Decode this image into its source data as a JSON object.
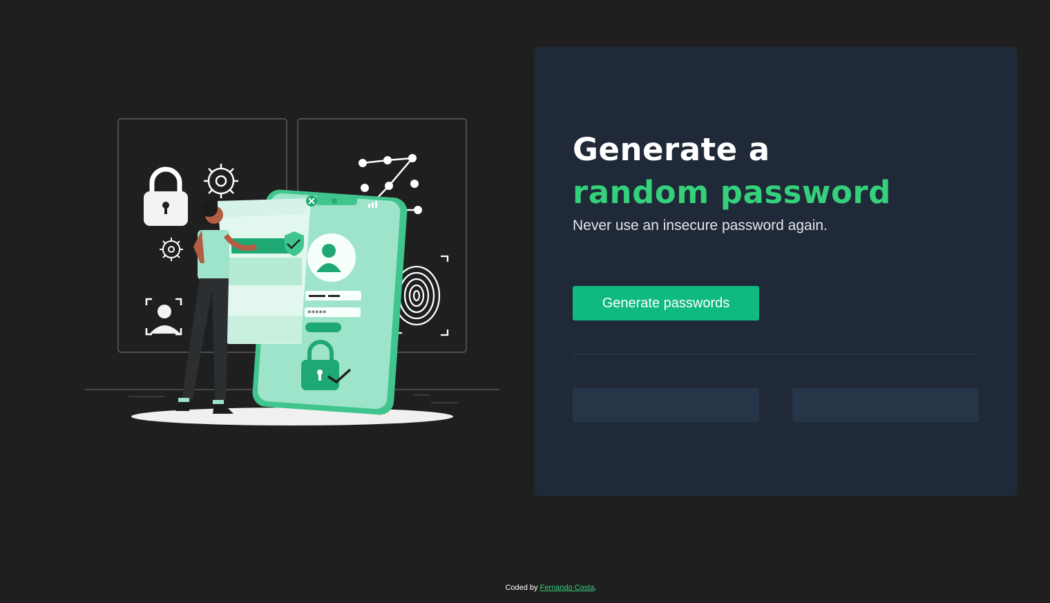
{
  "hero": {
    "title_line1": "Generate a",
    "title_line2": "random password",
    "subtitle": "Never use an insecure password again."
  },
  "actions": {
    "generate_label": "Generate passwords"
  },
  "passwords": {
    "first": "",
    "second": ""
  },
  "footer": {
    "prefix": "Coded by ",
    "author": "Fernando Costa",
    "suffix": "."
  },
  "colors": {
    "background": "#1f1f1f",
    "card": "#1f2937",
    "accent": "#34d07b",
    "button": "#10b981",
    "password_box": "#273549"
  },
  "illustration": {
    "icons": [
      "padlock-icon",
      "gear-icon",
      "user-scan-icon",
      "pattern-lock-icon",
      "fingerprint-icon",
      "smartphone-icon",
      "shield-check-icon"
    ]
  }
}
